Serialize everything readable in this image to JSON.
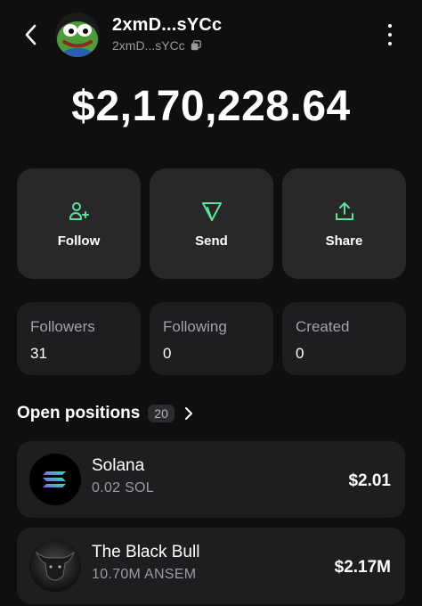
{
  "profile": {
    "name": "2xmD...sYCc",
    "address": "2xmD...sYCc"
  },
  "balance": "$2,170,228.64",
  "actions": [
    {
      "label": "Follow",
      "icon": "user-plus-icon"
    },
    {
      "label": "Send",
      "icon": "send-icon"
    },
    {
      "label": "Share",
      "icon": "share-icon"
    }
  ],
  "stats": [
    {
      "label": "Followers",
      "value": "31"
    },
    {
      "label": "Following",
      "value": "0"
    },
    {
      "label": "Created",
      "value": "0"
    }
  ],
  "positions": {
    "title": "Open positions",
    "count": "20",
    "items": [
      {
        "name": "Solana",
        "amount": "0.02 SOL",
        "value": "$2.01",
        "icon": "solana-logo"
      },
      {
        "name": "The Black Bull",
        "amount": "10.70M ANSEM",
        "value": "$2.17M",
        "icon": "black-bull-image"
      }
    ]
  },
  "colors": {
    "accent": "#5ee29a",
    "background": "#0f0f10",
    "card": "#28282b",
    "stat_card": "#1e1e21"
  }
}
